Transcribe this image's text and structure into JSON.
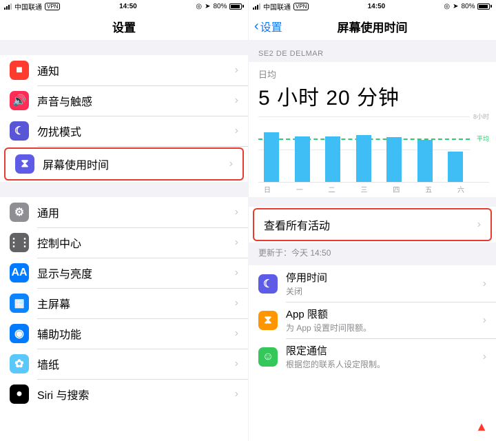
{
  "statusbar": {
    "carrier": "中国联通",
    "vpn": "VPN",
    "time": "14:50",
    "battery_pct": "80%",
    "location_glyph": "➤",
    "compass_glyph": "◎"
  },
  "left": {
    "nav_title": "设置",
    "rows_group1": [
      {
        "name": "notifications",
        "label": "通知",
        "icon": "■",
        "bg": "bg-red"
      },
      {
        "name": "sounds",
        "label": "声音与触感",
        "icon": "🔊",
        "bg": "bg-pink"
      },
      {
        "name": "dnd",
        "label": "勿扰模式",
        "icon": "☾",
        "bg": "bg-purple"
      },
      {
        "name": "screentime",
        "label": "屏幕使用时间",
        "icon": "⧗",
        "bg": "bg-indigo",
        "highlight": true
      }
    ],
    "rows_group2": [
      {
        "name": "general",
        "label": "通用",
        "icon": "⚙",
        "bg": "bg-gray"
      },
      {
        "name": "control-center",
        "label": "控制中心",
        "icon": "⋮⋮",
        "bg": "bg-gray2"
      },
      {
        "name": "display",
        "label": "显示与亮度",
        "icon": "AA",
        "bg": "bg-blue"
      },
      {
        "name": "home-screen",
        "label": "主屏幕",
        "icon": "▦",
        "bg": "bg-blue2"
      },
      {
        "name": "accessibility",
        "label": "辅助功能",
        "icon": "◉",
        "bg": "bg-blue"
      },
      {
        "name": "wallpaper",
        "label": "墙纸",
        "icon": "✿",
        "bg": "bg-cyan"
      },
      {
        "name": "siri",
        "label": "Siri 与搜索",
        "icon": "●",
        "bg": "bg-black"
      }
    ]
  },
  "right": {
    "back_label": "设置",
    "nav_title": "屏幕使用时间",
    "device_header": "SE2 DE DELMAR",
    "avg_label": "日均",
    "avg_value": "5 小时 20 分钟",
    "y_tick_label": "8小时",
    "avg_line_label": "平均",
    "view_all": "查看所有活动",
    "updated": "更新于：今天 14:50",
    "options": [
      {
        "name": "downtime",
        "label": "停用时间",
        "sub": "关闭",
        "icon": "☾",
        "bg": "bg-indigo"
      },
      {
        "name": "app-limits",
        "label": "App 限额",
        "sub": "为 App 设置时间限额。",
        "icon": "⧗",
        "bg": "bg-orange"
      },
      {
        "name": "communication",
        "label": "限定通信",
        "sub": "根据您的联系人设定限制。",
        "icon": "☺",
        "bg": "bg-green"
      }
    ]
  },
  "chart_data": {
    "type": "bar",
    "categories": [
      "日",
      "一",
      "二",
      "三",
      "四",
      "五",
      "六"
    ],
    "values": [
      6.1,
      5.6,
      5.6,
      5.7,
      5.5,
      5.1,
      3.7
    ],
    "unit": "hours",
    "ylim": [
      0,
      8
    ],
    "average": 5.33,
    "ylabel": "8小时",
    "avg_label": "平均",
    "title": "日均 5 小时 20 分钟"
  }
}
